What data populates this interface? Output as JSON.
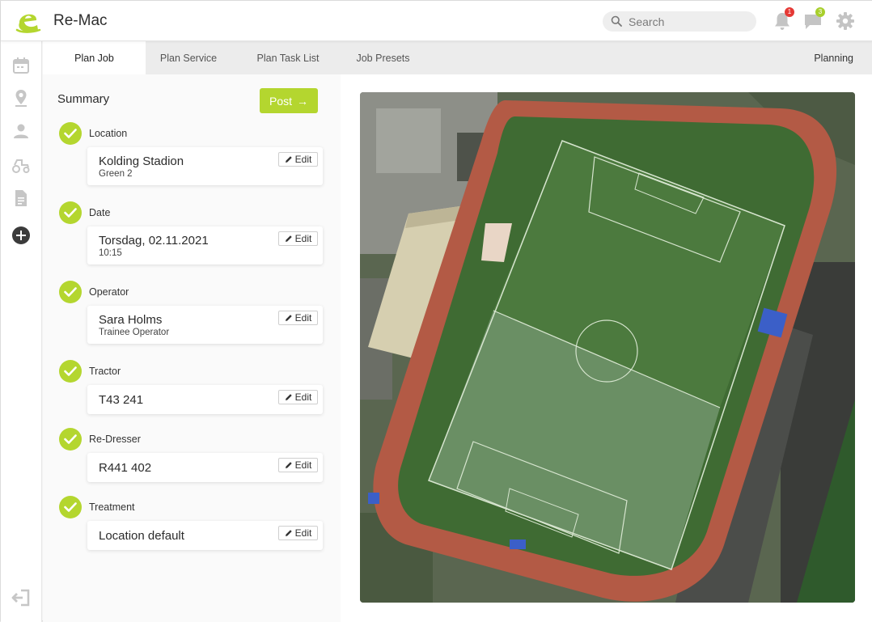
{
  "app": {
    "title": "Re-Mac"
  },
  "search": {
    "placeholder": "Search"
  },
  "header": {
    "notifications_count": "1",
    "messages_count": "3"
  },
  "tabs": [
    {
      "label": "Plan Job",
      "active": true
    },
    {
      "label": "Plan Service",
      "active": false
    },
    {
      "label": "Plan Task List",
      "active": false
    },
    {
      "label": "Job Presets",
      "active": false
    }
  ],
  "tabs_right": "Planning",
  "summary": {
    "title": "Summary",
    "post_label": "Post",
    "steps": [
      {
        "label": "Location",
        "main": "Kolding Stadion",
        "sub": "Green 2",
        "edit": "Edit"
      },
      {
        "label": "Date",
        "main": "Torsdag, 02.11.2021",
        "sub": "10:15",
        "edit": "Edit"
      },
      {
        "label": "Operator",
        "main": "Sara Holms",
        "sub": "Trainee Operator",
        "edit": "Edit"
      },
      {
        "label": "Tractor",
        "main": "T43 241",
        "sub": "",
        "edit": "Edit"
      },
      {
        "label": "Re-Dresser",
        "main": "R441 402",
        "sub": "",
        "edit": "Edit"
      },
      {
        "label": "Treatment",
        "main": "Location default",
        "sub": "",
        "edit": "Edit"
      }
    ]
  },
  "colors": {
    "accent": "#b4d62f",
    "track": "#b35a45",
    "grass": "#3f6b33"
  },
  "icons": {
    "nav": [
      "calendar-icon",
      "location-pin-icon",
      "user-icon",
      "tractor-icon",
      "document-icon",
      "add-circle-icon",
      "logout-icon"
    ],
    "header": [
      "search-icon",
      "bell-icon",
      "chat-icon",
      "gear-icon"
    ]
  }
}
